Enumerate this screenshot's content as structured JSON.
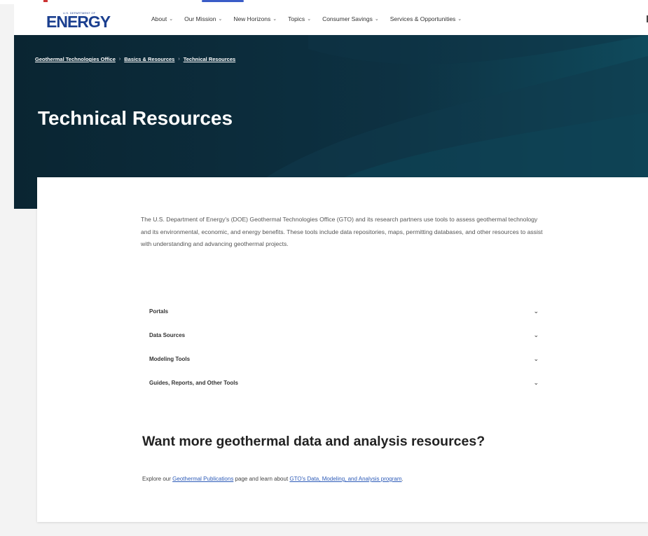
{
  "logo": {
    "text": "ENERGY",
    "small_text": "U.S. DEPARTMENT OF"
  },
  "nav": [
    {
      "label": "About"
    },
    {
      "label": "Our Mission"
    },
    {
      "label": "New Horizons"
    },
    {
      "label": "Topics"
    },
    {
      "label": "Consumer Savings"
    },
    {
      "label": "Services & Opportunities"
    }
  ],
  "breadcrumb": {
    "items": [
      "Geothermal Technologies Office",
      "Basics & Resources",
      "Technical Resources"
    ],
    "separator": "›"
  },
  "hero": {
    "title": "Technical Resources"
  },
  "intro": "The U.S. Department of Energy's (DOE) Geothermal Technologies Office (GTO) and its research partners use tools to assess geothermal technology and its environmental, economic, and energy benefits. These tools include data repositories, maps, permitting databases, and other resources to assist with understanding and advancing geothermal projects.",
  "accordion": [
    {
      "label": "Portals"
    },
    {
      "label": "Data Sources"
    },
    {
      "label": "Modeling Tools"
    },
    {
      "label": "Guides, Reports, and Other Tools"
    }
  ],
  "more": {
    "title": "Want more geothermal data and analysis resources?",
    "text_before": "Explore our",
    "link1": "Geothermal Publications",
    "text_middle": "page and learn about",
    "link2": "GTO's Data, Modeling, and Analysis program",
    "text_after": "."
  },
  "icons": {
    "chevron": "chevron-down-icon"
  },
  "colors": {
    "brand": "#1b3f8f",
    "hero_bg": "#0b2a3a",
    "link": "#2d5bb8"
  }
}
